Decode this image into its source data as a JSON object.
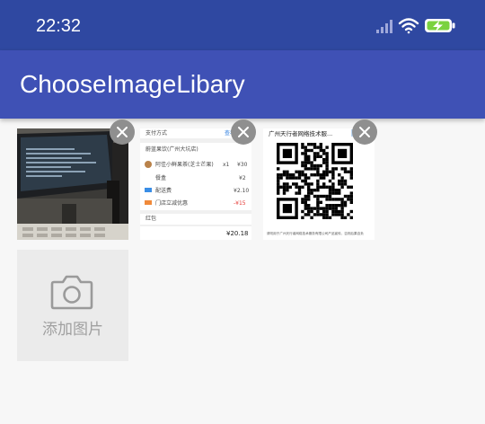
{
  "status_bar": {
    "time": "22:32"
  },
  "app_bar": {
    "title": "ChooseImageLibary"
  },
  "images": [
    {
      "alt": "computer-monitor-photo"
    },
    {
      "alt": "payment-receipt-screenshot",
      "header_title": "支付方式",
      "header_link": "查看订单",
      "store_name": "蔚蓝果饮(广州大坑店)",
      "line1": "阿佳小鲜果茶(芝士芒果)",
      "line1_qty": "x1",
      "line1_price": "¥30",
      "line2": "餐盒",
      "line2_price": "¥2",
      "line3": "配送费",
      "line3_price": "¥2.10",
      "line4": "门店立减优惠",
      "line4_price": "-¥15",
      "section_label": "红包",
      "total": "¥20.18"
    },
    {
      "alt": "qr-code-screenshot",
      "title": "广州天行者网络技术服...",
      "footer": "请勿用于广州天行者网络技术服务有限公司产品宣传，否则后果自负"
    }
  ],
  "add_tile": {
    "label": "添加图片",
    "icon": "camera-icon"
  }
}
